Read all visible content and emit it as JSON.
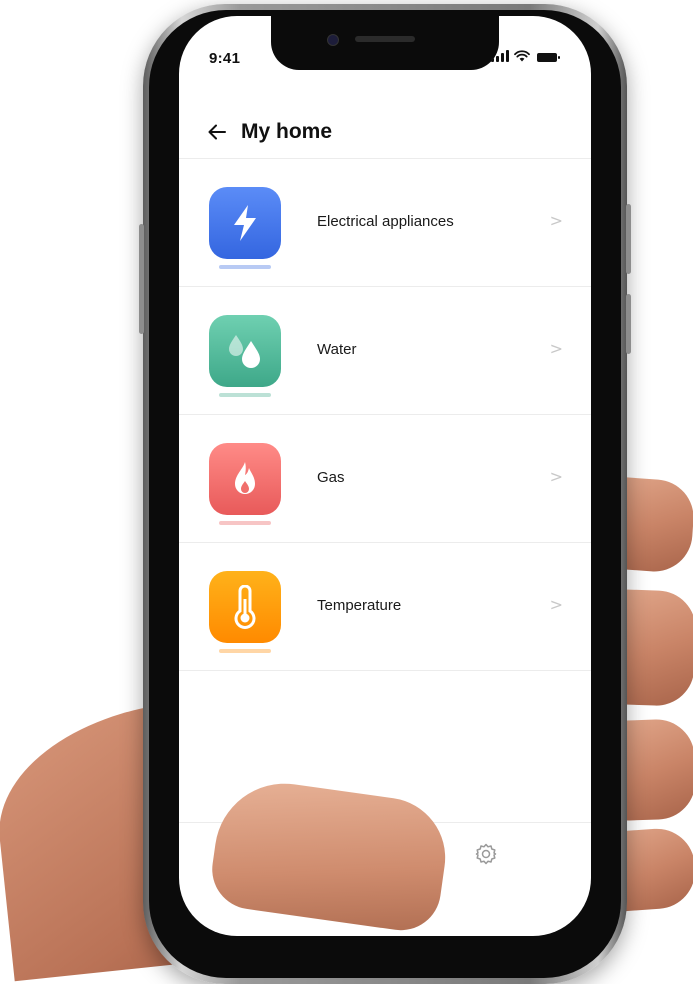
{
  "status_bar": {
    "time": "9:41"
  },
  "header": {
    "title": "My home",
    "back_icon": "back-arrow-icon"
  },
  "categories": [
    {
      "label": "Electrical appliances",
      "icon": "lightning-icon",
      "color_top": "#5b8cf7",
      "color_bottom": "#3466e0"
    },
    {
      "label": "Water",
      "icon": "water-drop-icon",
      "color_top": "#6fd0b1",
      "color_bottom": "#3ea889"
    },
    {
      "label": "Gas",
      "icon": "flame-icon",
      "color_top": "#ff8b87",
      "color_bottom": "#e85a5a"
    },
    {
      "label": "Temperature",
      "icon": "thermometer-icon",
      "color_top": "#ffb21a",
      "color_bottom": "#ff8a00"
    }
  ],
  "chevron": ">",
  "tabbar": {
    "items": [
      {
        "icon": "pie-chart-icon",
        "active": true,
        "color": "#3b6ef0"
      },
      {
        "icon": "gear-icon",
        "active": false,
        "color": "#9a9a9a"
      }
    ]
  }
}
